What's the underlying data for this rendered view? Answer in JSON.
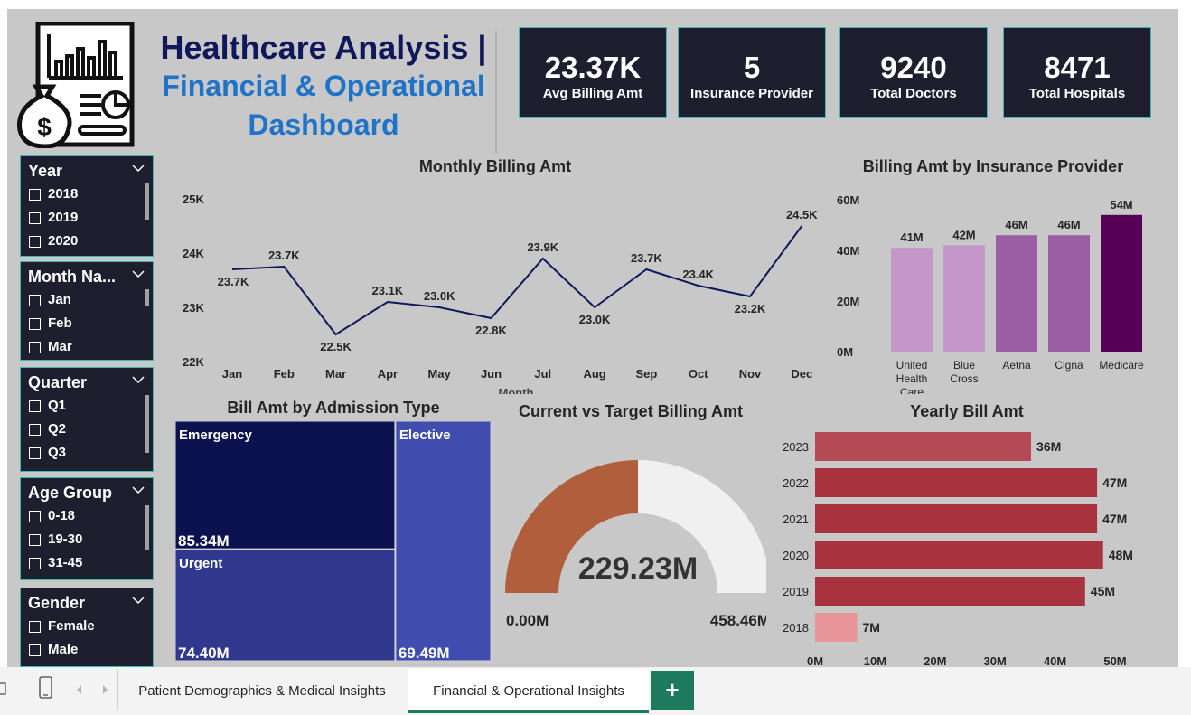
{
  "header": {
    "title_line1": "Healthcare Analysis |",
    "title_line2": "Financial & Operational",
    "title_line3": "Dashboard",
    "logo_icon": "finance-report-money-bag-icon"
  },
  "kpis": [
    {
      "value": "23.37K",
      "label": "Avg Billing Amt"
    },
    {
      "value": "5",
      "label": "Insurance Provider"
    },
    {
      "value": "9240",
      "label": "Total Doctors"
    },
    {
      "value": "8471",
      "label": "Total Hospitals"
    }
  ],
  "slicers": [
    {
      "title": "Year",
      "items": [
        "2018",
        "2019",
        "2020"
      ]
    },
    {
      "title": "Month Na...",
      "items": [
        "Jan",
        "Feb",
        "Mar"
      ]
    },
    {
      "title": "Quarter",
      "items": [
        "Q1",
        "Q2",
        "Q3"
      ]
    },
    {
      "title": "Age Group",
      "items": [
        "0-18",
        "19-30",
        "31-45"
      ]
    },
    {
      "title": "Gender",
      "items": [
        "Female",
        "Male"
      ]
    }
  ],
  "colors": {
    "dark_panel": "#1e1e2e",
    "teal_border": "#3fb7b2",
    "line": "#10185a",
    "gauge_value": "#b05e3c",
    "gauge_rest": "#f0f0f0",
    "yearly_bar": "#a8333e",
    "yearly_bar_2018": "#e8959a"
  },
  "chart_data": [
    {
      "type": "line",
      "title": "Monthly Billing Amt",
      "xlabel": "Month",
      "categories": [
        "Jan",
        "Feb",
        "Mar",
        "Apr",
        "May",
        "Jun",
        "Jul",
        "Aug",
        "Sep",
        "Oct",
        "Nov",
        "Dec"
      ],
      "values": [
        23.7,
        23.75,
        22.5,
        23.1,
        23.0,
        22.8,
        23.9,
        23.0,
        23.7,
        23.4,
        23.2,
        24.5
      ],
      "data_labels": [
        "23.7K",
        "23.7K",
        "22.5K",
        "23.1K",
        "23.0K",
        "22.8K",
        "23.9K",
        "23.0K",
        "23.7K",
        "23.4K",
        "23.2K",
        "24.5K"
      ],
      "yticks": [
        "22K",
        "23K",
        "24K",
        "25K"
      ],
      "ylim": [
        22,
        25
      ]
    },
    {
      "type": "bar",
      "title": "Billing Amt by Insurance Provider",
      "categories": [
        "United Health Care",
        "Blue Cross",
        "Aetna",
        "Cigna",
        "Medicare"
      ],
      "values": [
        41,
        42,
        46,
        46,
        54
      ],
      "data_labels": [
        "41M",
        "42M",
        "46M",
        "46M",
        "54M"
      ],
      "colors": [
        "#c596c8",
        "#c596c8",
        "#9b5da3",
        "#9b5da3",
        "#560058"
      ],
      "yticks": [
        "0M",
        "20M",
        "40M",
        "60M"
      ],
      "ylim": [
        0,
        60
      ]
    },
    {
      "type": "treemap",
      "title": "Bill Amt by Admission Type",
      "categories": [
        "Emergency",
        "Urgent",
        "Elective"
      ],
      "values": [
        85.34,
        74.4,
        69.49
      ],
      "data_labels": [
        "85.34M",
        "74.40M",
        "69.49M"
      ],
      "colors": [
        "#0b124f",
        "#2f388d",
        "#404daf"
      ]
    },
    {
      "type": "gauge",
      "title": "Current vs Target Billing Amt",
      "value": 229.23,
      "value_label": "229.23M",
      "min_label": "0.00M",
      "max_label": "458.46M",
      "range": [
        0,
        458.46
      ]
    },
    {
      "type": "bar",
      "orientation": "horizontal",
      "title": "Yearly Bill Amt",
      "categories": [
        "2023",
        "2022",
        "2021",
        "2020",
        "2019",
        "2018"
      ],
      "values": [
        36,
        47,
        47,
        48,
        45,
        7
      ],
      "data_labels": [
        "36M",
        "47M",
        "47M",
        "48M",
        "45M",
        "7M"
      ],
      "xticks": [
        "0M",
        "10M",
        "20M",
        "30M",
        "40M",
        "50M"
      ],
      "xlim": [
        0,
        50
      ]
    }
  ],
  "tabs": {
    "page1": "Patient Demographics & Medical Insights",
    "page2": "Financial & Operational Insights",
    "add_label": "+",
    "active": "Financial & Operational Insights"
  }
}
